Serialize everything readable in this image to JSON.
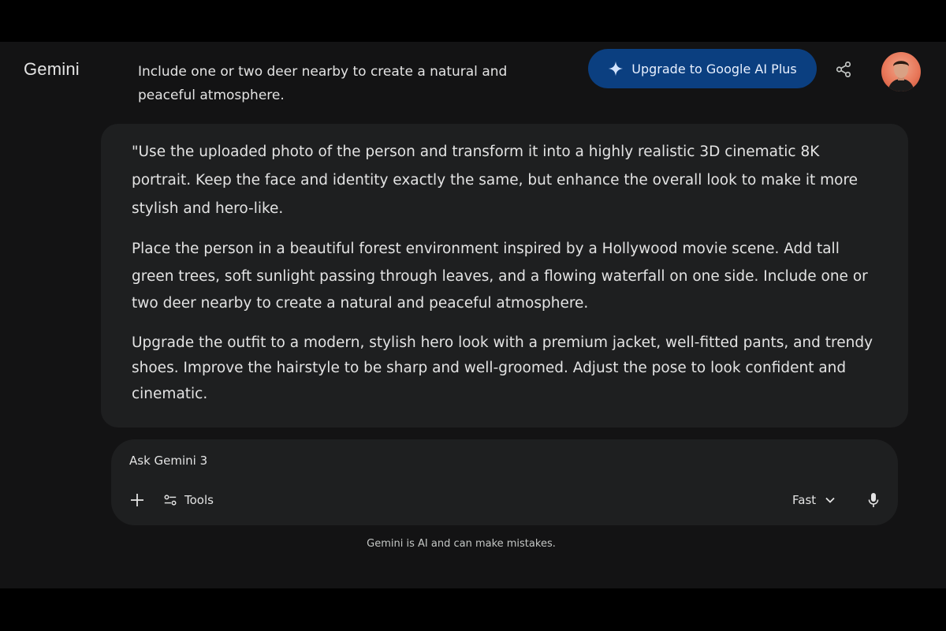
{
  "header": {
    "brand": "Gemini",
    "conversation_title": "Include one or two deer nearby to create a natural and peaceful atmosphere.",
    "upgrade_label": "Upgrade to Google AI Plus",
    "icons": {
      "upgrade": "sparkle-icon",
      "share": "share-icon",
      "avatar": "user-avatar"
    }
  },
  "prompt": {
    "paragraphs": [
      "\"Use the uploaded photo of the person and transform it into a highly realistic 3D cinematic 8K portrait. Keep the face and identity exactly the same, but enhance the overall look to make it more stylish and hero-like.",
      "Place the person in a beautiful forest environment inspired by a Hollywood movie scene. Add tall green trees, soft sunlight passing through leaves, and a flowing waterfall on one side. Include one or two deer nearby to create a natural and peaceful atmosphere.",
      "Upgrade the outfit to a modern, stylish hero look with a premium jacket, well-fitted pants, and trendy shoes. Improve the hairstyle to be sharp and well-groomed. Adjust the pose to look confident and cinematic."
    ]
  },
  "composer": {
    "placeholder": "Ask Gemini 3",
    "tools_label": "Tools",
    "mode_label": "Fast",
    "icons": {
      "add": "plus-icon",
      "tools": "tools-sliders-icon",
      "mode": "chevron-down-icon",
      "mic": "microphone-icon"
    }
  },
  "footer": {
    "disclaimer": "Gemini is AI and can make mistakes."
  },
  "colors": {
    "background": "#131314",
    "surface": "#1e1f20",
    "text": "#e3e3e3",
    "upgrade_button": "#0b3f80"
  }
}
